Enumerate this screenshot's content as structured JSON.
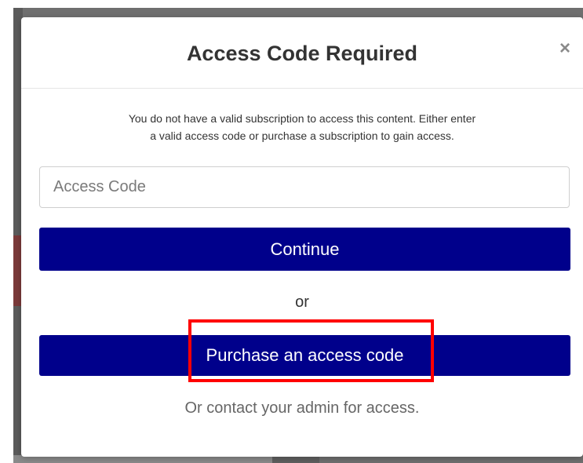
{
  "modal": {
    "title": "Access Code Required",
    "close_label": "×",
    "message_line1": "You do not have a valid subscription to access this content. Either enter",
    "message_line2": "a valid access code or purchase a subscription to gain access.",
    "access_code_placeholder": "Access Code",
    "access_code_value": "",
    "continue_label": "Continue",
    "or_label": "or",
    "purchase_label": "Purchase an access code",
    "contact_label": "Or contact your admin for access."
  },
  "colors": {
    "primary_button": "#00008b",
    "highlight": "#ff0000",
    "backdrop": "#6f6f6f"
  }
}
